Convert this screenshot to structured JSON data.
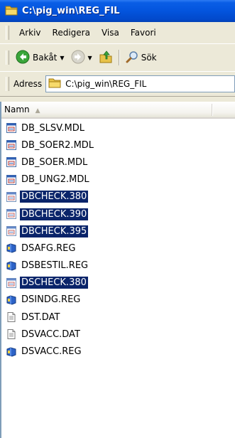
{
  "window": {
    "title": "C:\\pig_win\\REG_FIL"
  },
  "menubar": {
    "items": [
      {
        "label": "Arkiv"
      },
      {
        "label": "Redigera"
      },
      {
        "label": "Visa"
      },
      {
        "label": "Favori"
      }
    ]
  },
  "toolbar": {
    "back_label": "Bakåt",
    "search_label": "Sök"
  },
  "address": {
    "label": "Adress",
    "path": "C:\\pig_win\\REG_FIL"
  },
  "list": {
    "column_name": "Namn",
    "files": [
      {
        "name": "DB_SLSV.MDL",
        "icon": "mdl-file-icon",
        "selected": false
      },
      {
        "name": "DB_SOER2.MDL",
        "icon": "mdl-file-icon",
        "selected": false
      },
      {
        "name": "DB_SOER.MDL",
        "icon": "mdl-file-icon",
        "selected": false
      },
      {
        "name": "DB_UNG2.MDL",
        "icon": "mdl-file-icon",
        "selected": false
      },
      {
        "name": "DBCHECK.380",
        "icon": "mdl-file-icon",
        "selected": true
      },
      {
        "name": "DBCHECK.390",
        "icon": "mdl-file-icon",
        "selected": true
      },
      {
        "name": "DBCHECK.395",
        "icon": "mdl-file-icon",
        "selected": true
      },
      {
        "name": "DSAFG.REG",
        "icon": "reg-file-icon",
        "selected": false
      },
      {
        "name": "DSBESTIL.REG",
        "icon": "reg-file-icon",
        "selected": false
      },
      {
        "name": "DSCHECK.380",
        "icon": "mdl-file-icon",
        "selected": true
      },
      {
        "name": "DSINDG.REG",
        "icon": "reg-file-icon",
        "selected": false
      },
      {
        "name": "DST.DAT",
        "icon": "dat-file-icon",
        "selected": false
      },
      {
        "name": "DSVACC.DAT",
        "icon": "dat-file-icon",
        "selected": false
      },
      {
        "name": "DSVACC.REG",
        "icon": "reg-file-icon",
        "selected": false
      }
    ]
  },
  "colors": {
    "title_bar": "#0354dd",
    "selection": "#0a246a",
    "chrome": "#ece9d8"
  }
}
